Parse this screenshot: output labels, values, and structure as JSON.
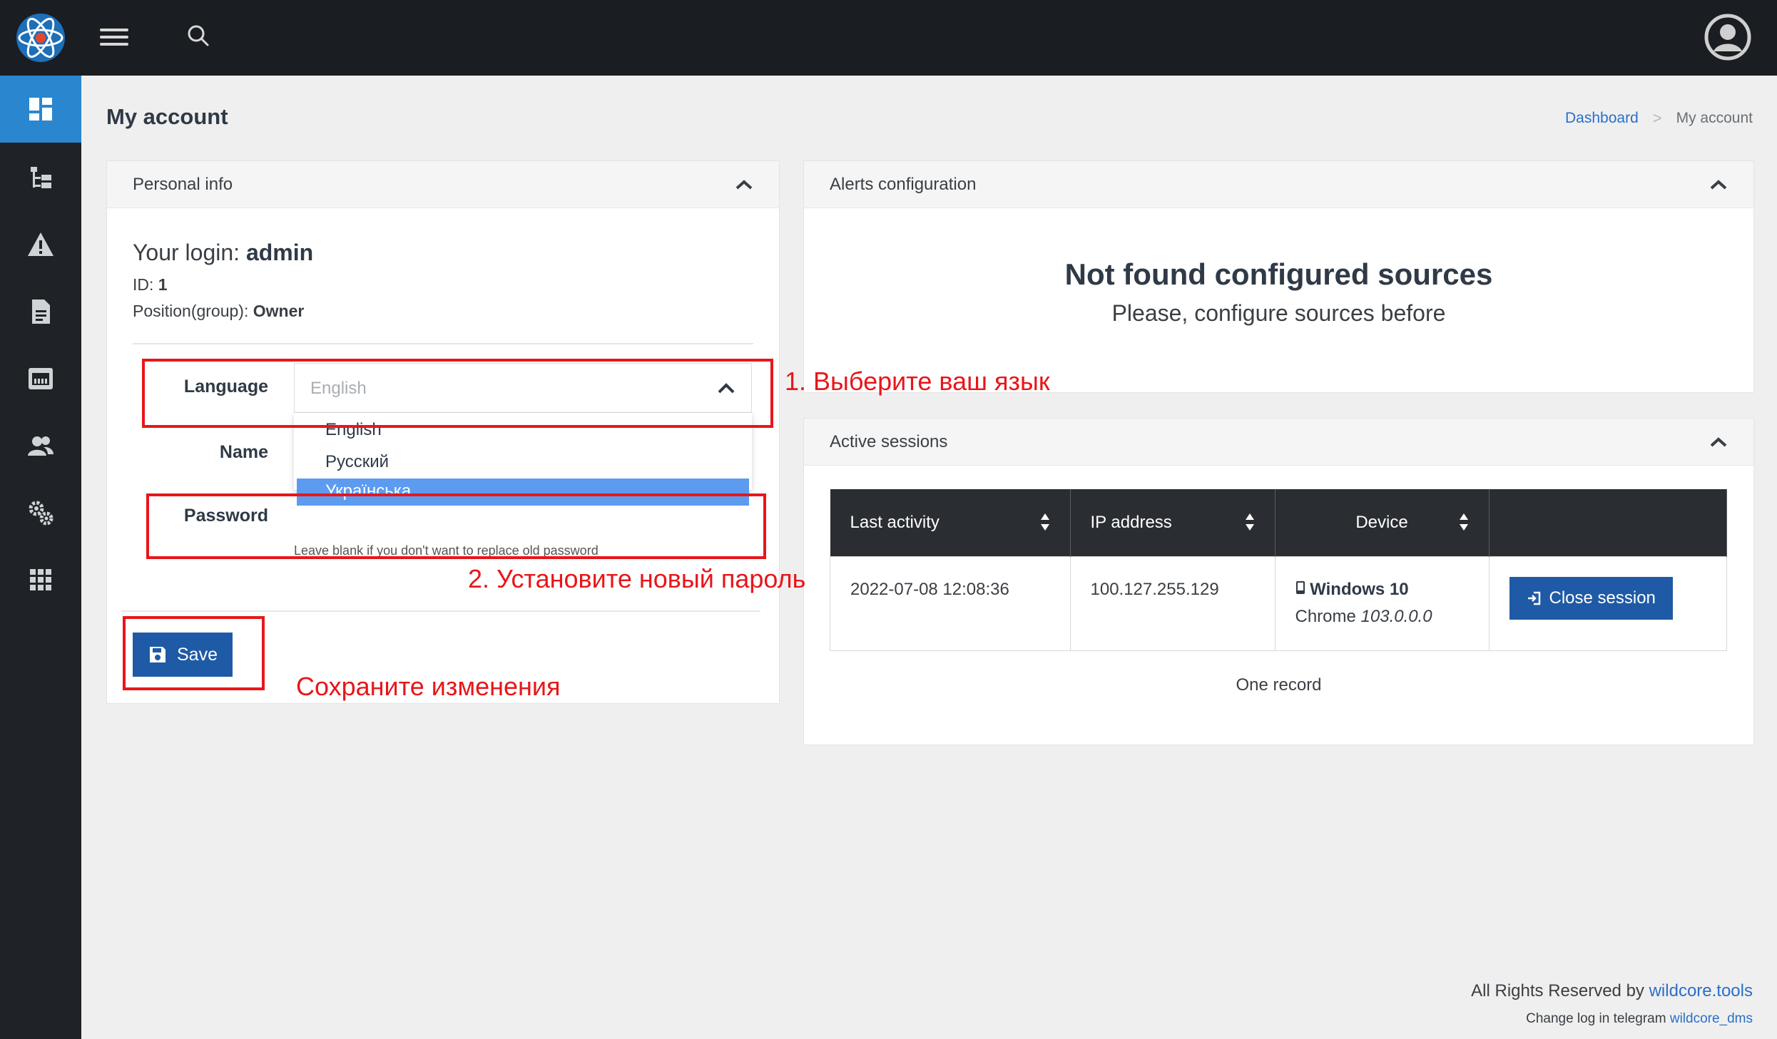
{
  "topbar": {
    "logo_icon": "atom-logo-icon",
    "menu_icon": "hamburger-menu-icon",
    "search_icon": "search-icon",
    "user_icon": "user-avatar-icon"
  },
  "sidebar": {
    "items": [
      {
        "icon": "dashboard-icon",
        "active": true
      },
      {
        "icon": "tree-icon",
        "active": false
      },
      {
        "icon": "warning-icon",
        "active": false
      },
      {
        "icon": "document-icon",
        "active": false
      },
      {
        "icon": "network-port-icon",
        "active": false
      },
      {
        "icon": "users-icon",
        "active": false
      },
      {
        "icon": "settings-icon",
        "active": false
      },
      {
        "icon": "apps-grid-icon",
        "active": false
      }
    ]
  },
  "page": {
    "title": "My account",
    "breadcrumb": {
      "home": "Dashboard",
      "sep": ">",
      "current": "My account"
    }
  },
  "personal": {
    "header": "Personal info",
    "login_prefix": "Your login: ",
    "login": "admin",
    "id_prefix": "ID: ",
    "id": "1",
    "position_prefix": "Position(group): ",
    "position": "Owner",
    "language_label": "Language",
    "language_value": "English",
    "language_options": [
      "English",
      "Русский",
      "Українська"
    ],
    "language_highlighted": "Українська",
    "name_label": "Name",
    "password_label": "Password",
    "password_hint": "Leave blank if you don't want to replace old password",
    "save_label": "Save"
  },
  "alerts": {
    "header": "Alerts configuration",
    "title": "Not found configured sources",
    "subtitle": "Please, configure sources before"
  },
  "sessions": {
    "header": "Active sessions",
    "columns": [
      "Last activity",
      "IP address",
      "Device",
      ""
    ],
    "rows": [
      {
        "last_activity": "2022-07-08 12:08:36",
        "ip": "100.127.255.129",
        "device_os": "Windows 10",
        "device_browser": "Chrome ",
        "device_version": "103.0.0.0",
        "action": "Close session"
      }
    ],
    "footer": "One record"
  },
  "annotations": {
    "step1": "1. Выберите ваш язык",
    "step2": "2. Установите новый пароль",
    "step3": "Сохраните изменения",
    "color": "#e8161a"
  },
  "footer": {
    "rights_prefix": "All Rights Reserved by ",
    "rights_link": "wildcore.tools",
    "changelog_prefix": "Change log in telegram ",
    "changelog_link": "wildcore_dms"
  },
  "colors": {
    "topbar": "#1a1d21",
    "sidebar": "#1f2327",
    "sidebar_active": "#2a86cf",
    "primary_button": "#1f5aa6",
    "link": "#2a6fc9",
    "dropdown_selected": "#5c9bf0"
  }
}
